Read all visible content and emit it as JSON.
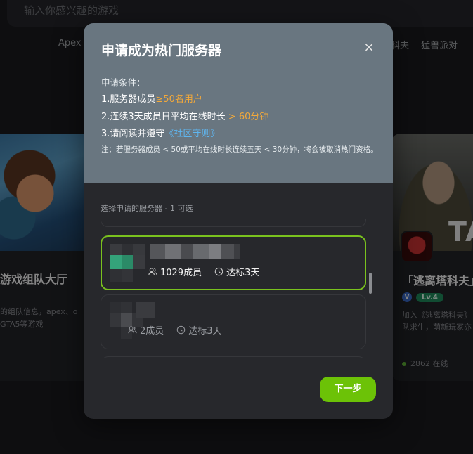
{
  "search": {
    "placeholder": "输入你感兴趣的游戏"
  },
  "tags": [
    "Apex",
    "科夫",
    "猛兽派对"
  ],
  "left_card": {
    "title": "游戏组队大厅",
    "desc_line1": "的组队信息，apex、o",
    "desc_line2": "GTA5等游戏"
  },
  "right_card": {
    "title": "「逃离塔科夫」",
    "art_letters": "TA",
    "verified_badge": "V",
    "level_badge": "Lv.4",
    "desc_line1": "加入《逃离塔科夫》",
    "desc_line2": "队求生，萌新玩家亦",
    "online": "2862 在线"
  },
  "modal": {
    "title": "申请成为热门服务器",
    "close_label": "×",
    "conditions_heading": "申请条件：",
    "cond1_text": "1.服务器成员",
    "cond1_highlight": "≥50名用户",
    "cond2_text": "2.连续3天成员日平均在线时长",
    "cond2_highlight": " > 60分钟",
    "cond3_text": "3.请阅读并遵守",
    "cond3_link": "《社区守则》",
    "note": "注：若服务器成员 < 50或平均在线时长连续五天 < 30分钟，将会被取消热门资格。",
    "select_label": "选择申请的服务器 - 1 可选",
    "servers": [
      {
        "members": "1029成员",
        "qualified": "达标3天",
        "selected": true
      },
      {
        "members": "2成员",
        "qualified": "达标3天",
        "selected": false
      }
    ],
    "next_button": "下一步"
  },
  "colors": {
    "accent_green": "#6cc207",
    "selected_border": "#7ac21e",
    "highlight_orange": "#f3a93a",
    "link_blue": "#5fb6f0",
    "header_bg": "#697680"
  },
  "icons": [
    "close-icon",
    "users-icon",
    "clock-icon",
    "verified-icon",
    "online-dot-icon"
  ]
}
